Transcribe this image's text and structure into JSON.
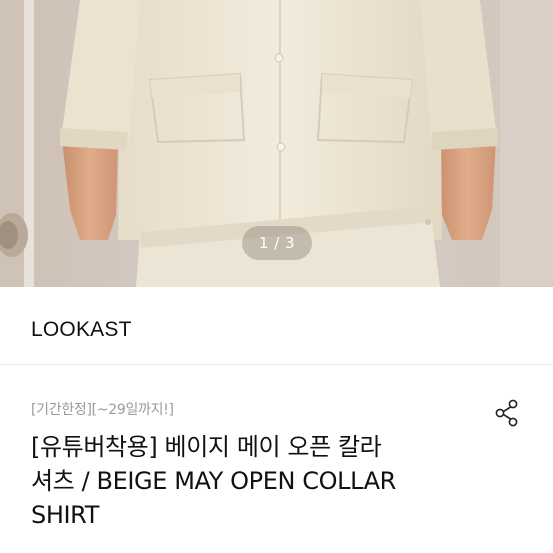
{
  "carousel": {
    "current": 1,
    "total": 3,
    "indicator_text": "1 / 3"
  },
  "product": {
    "brand": "LOOKAST",
    "promo_label": "[기간한정][~29일까지!]",
    "title_line1": "[유튜버착용] 베이지 메이 오픈 칼라",
    "title_line2": "셔츠 / BEIGE MAY OPEN COLLAR",
    "title_line3": "SHIRT"
  },
  "icons": {
    "share": "share-icon"
  },
  "colors": {
    "shirt": "#efe7d6",
    "skin": "#d8a27f",
    "background": "#d3c8bf",
    "text": "#111111",
    "muted": "#9a9a9a"
  }
}
